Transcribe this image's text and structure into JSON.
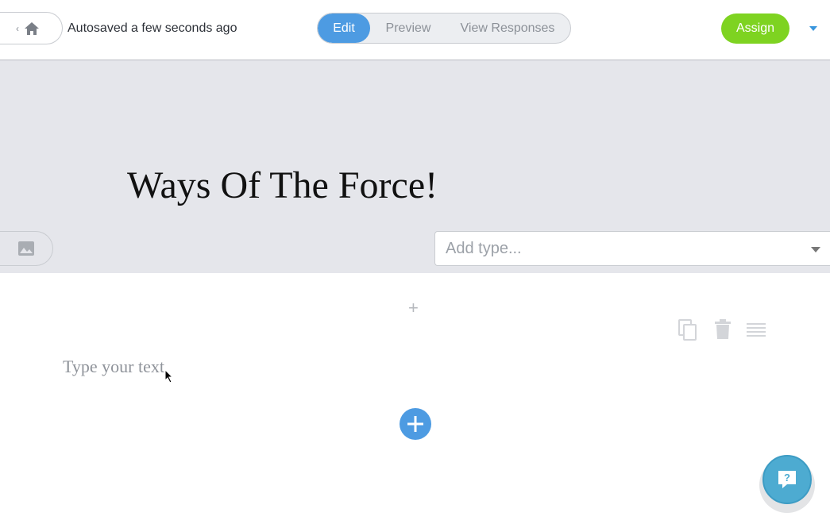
{
  "topbar": {
    "home_icon": "home-icon",
    "back_icon": "chevron-left-icon",
    "autosave_text": "Autosaved a few seconds ago",
    "tabs": [
      {
        "label": "Edit",
        "active": true
      },
      {
        "label": "Preview",
        "active": false
      },
      {
        "label": "View Responses",
        "active": false
      }
    ],
    "assign_label": "Assign",
    "accent_color": "#4d9be2",
    "assign_color": "#7ed321"
  },
  "header": {
    "title": "Ways Of The Force!",
    "image_icon": "image-icon",
    "type_placeholder": "Add type..."
  },
  "content": {
    "text_placeholder": "Type your text",
    "tools": [
      "copy-icon",
      "trash-icon",
      "drag-handle-icon"
    ],
    "add_icon": "plus-circle-icon",
    "help_icon": "help-chat-icon"
  }
}
